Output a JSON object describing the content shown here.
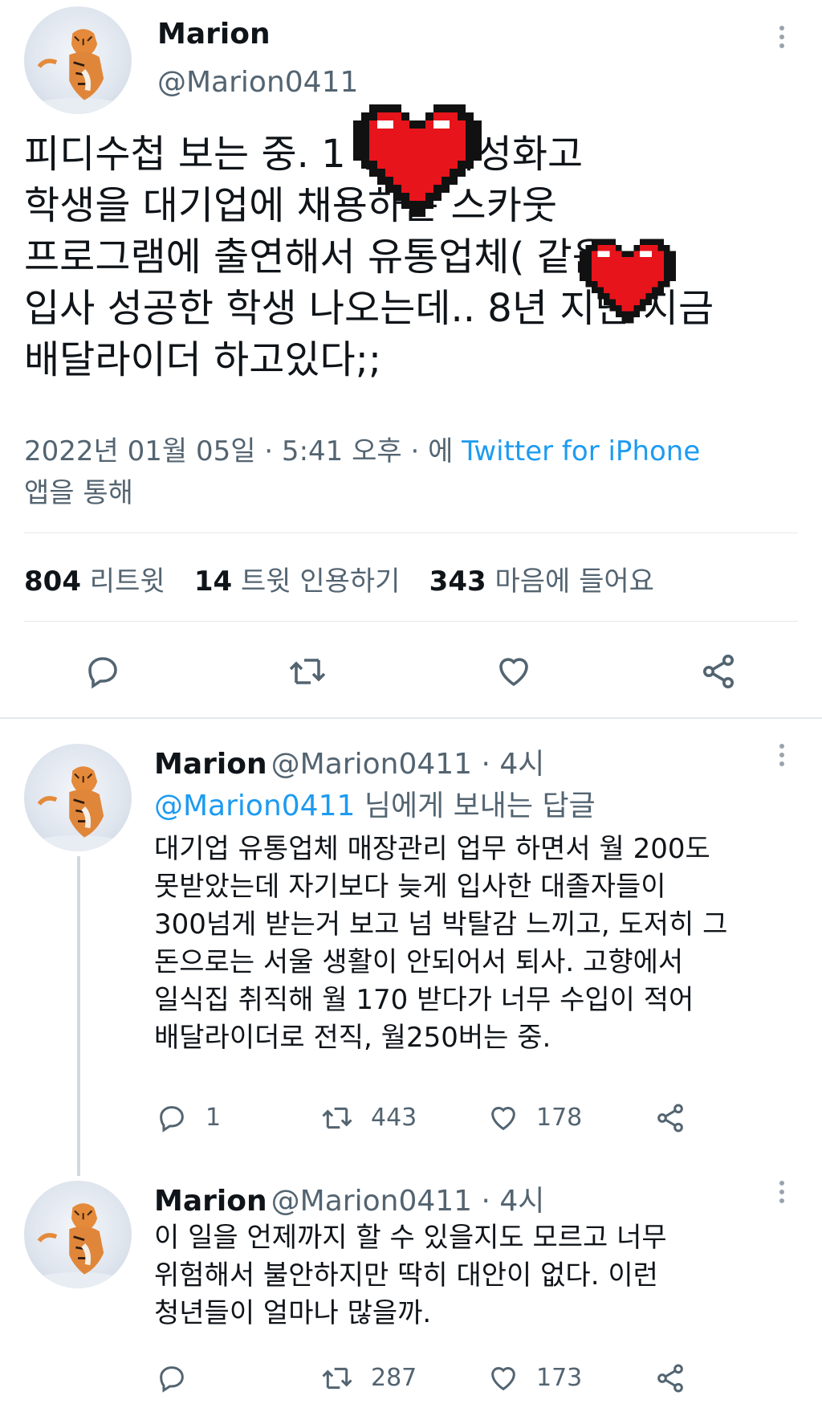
{
  "main_tweet": {
    "name": "Marion",
    "handle": "@Marion0411",
    "text_lines": [
      "피디수첩 보는 중. 1        편때 특성화고",
      "학생을 대기업에 채용하는 스카웃",
      "프로그램에 출연해서 유통업체(        같음)",
      "입사 성공한 학생 나오는데.. 8년 지난 지금",
      "배달라이더 하고있다;;"
    ],
    "meta_time": "2022년 01월 05일 · 5:41 오후 · 에 ",
    "meta_source": "Twitter for iPhone",
    "meta_suffix": "앱을 통해",
    "stats": {
      "retweets_count": "804",
      "retweets_label": "리트윗",
      "quotes_count": "14",
      "quotes_label": "트윗 인용하기",
      "likes_count": "343",
      "likes_label": "마음에 들어요"
    }
  },
  "replies": [
    {
      "name": "Marion",
      "handle": "@Marion0411 · 4시",
      "reply_to_handle": "@Marion0411",
      "reply_to_suffix": " 님에게 보내는 답글",
      "lines": [
        "대기업 유통업체 매장관리 업무 하면서 월 200도",
        "못받았는데 자기보다 늦게 입사한 대졸자들이",
        "300넘게 받는거 보고 넘 박탈감 느끼고, 도저히 그",
        "돈으로는 서울 생활이 안되어서 퇴사. 고향에서",
        "일식집 취직해 월 170 받다가 너무 수입이 적어",
        "배달라이더로 전직, 월250버는 중."
      ],
      "reply_count": "1",
      "retweet_count": "443",
      "like_count": "178"
    },
    {
      "name": "Marion",
      "handle": "@Marion0411 · 4시",
      "lines": [
        "이 일을 언제까지 할 수 있을지도 모르고 너무",
        "위험해서 불안하지만 딱히 대안이 없다. 이런",
        "청년들이 얼마나 많을까."
      ],
      "reply_count": "",
      "retweet_count": "287",
      "like_count": "173"
    }
  ],
  "icons": {
    "reply": "reply-icon",
    "retweet": "retweet-icon",
    "like": "heart-icon",
    "share": "share-icon",
    "more": "more-icon",
    "redaction": "pixel-heart-sticker"
  },
  "colors": {
    "text": "#0f1419",
    "muted": "#536471",
    "link": "#1d9bf0",
    "divider": "#e4e8eb",
    "sticker": "#e8141b"
  }
}
